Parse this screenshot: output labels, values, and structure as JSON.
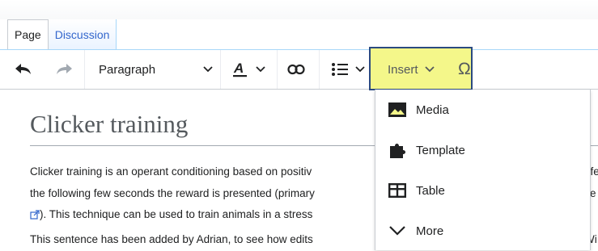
{
  "tabs": [
    {
      "label": "Page"
    },
    {
      "label": "Discussion"
    }
  ],
  "toolbar": {
    "undo_icon": "undo-icon",
    "redo_icon": "redo-icon",
    "paragraph_label": "Paragraph",
    "text_style_icon": "text-style-icon",
    "link_icon": "link-icon",
    "list_icon": "bulleted-list-icon",
    "insert_label": "Insert",
    "special_char_label": "Ω"
  },
  "insert_menu": {
    "items": [
      {
        "label": "Media",
        "icon": "image-icon"
      },
      {
        "label": "Template",
        "icon": "puzzle-icon"
      },
      {
        "label": "Table",
        "icon": "table-icon"
      },
      {
        "label": "More",
        "icon": "chevron-down-icon"
      }
    ]
  },
  "article": {
    "title": "Clicker training",
    "line1": "Clicker training is an operant conditioning based on positiv",
    "line1_right": "ffe",
    "line2": "the following few seconds the reward is presented (primary",
    "line2_right": "e",
    "line3": "). This technique can be used to train animals in a stress",
    "line4": "This sentence has been added by Adrian, to see how edits",
    "line4_right": "Wi"
  },
  "colors": {
    "highlight": "#f4f78a",
    "highlight_border": "#2b4a80",
    "link": "#3366cc"
  }
}
